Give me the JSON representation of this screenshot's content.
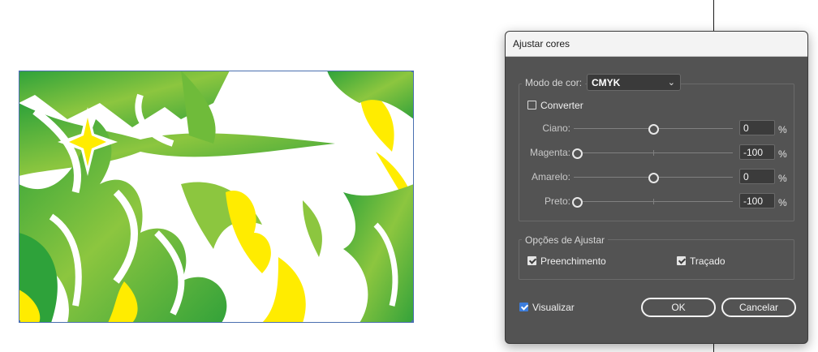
{
  "dialog": {
    "title": "Ajustar cores",
    "color_mode_label": "Modo de cor:",
    "color_mode_value": "CMYK",
    "convert_label": "Converter",
    "sliders": [
      {
        "label": "Ciano:",
        "value": "0",
        "unit": "%",
        "level": 0.5
      },
      {
        "label": "Magenta:",
        "value": "-100",
        "unit": "%",
        "level": 0
      },
      {
        "label": "Amarelo:",
        "value": "0",
        "unit": "%",
        "level": 0.5
      },
      {
        "label": "Preto:",
        "value": "-100",
        "unit": "%",
        "level": 0
      }
    ],
    "options_label": "Opções de Ajustar",
    "fill_label": "Preenchimento",
    "stroke_label": "Traçado",
    "preview_label": "Visualizar",
    "ok_label": "OK",
    "cancel_label": "Cancelar"
  },
  "colors": {
    "dialog_bg": "#535353",
    "art_green_dark": "#2ea23a",
    "art_green_light": "#8cc63f",
    "art_yellow": "#ffec00",
    "accent_checkbox": "#3c7ddc"
  }
}
